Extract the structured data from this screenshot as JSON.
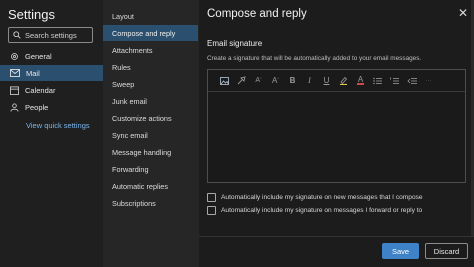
{
  "left": {
    "title": "Settings",
    "search_placeholder": "Search settings",
    "items": [
      {
        "label": "General",
        "icon": "gear-icon"
      },
      {
        "label": "Mail",
        "icon": "mail-icon"
      },
      {
        "label": "Calendar",
        "icon": "calendar-icon"
      },
      {
        "label": "People",
        "icon": "people-icon"
      }
    ],
    "quick_link": "View quick settings"
  },
  "middle": {
    "items": [
      "Layout",
      "Compose and reply",
      "Attachments",
      "Rules",
      "Sweep",
      "Junk email",
      "Customize actions",
      "Sync email",
      "Message handling",
      "Forwarding",
      "Automatic replies",
      "Subscriptions"
    ],
    "active_index": 1
  },
  "main": {
    "title": "Compose and reply",
    "section_title": "Email signature",
    "description": "Create a signature that will be automatically added to your email messages.",
    "toolbar_icons": [
      "image-icon",
      "format-painter-icon",
      "font-size-decrease-icon",
      "font-size-increase-icon",
      "bold-icon",
      "italic-icon",
      "underline-icon",
      "highlight-icon",
      "font-color-icon",
      "bullets-icon",
      "numbering-icon",
      "decrease-indent-icon"
    ],
    "toolbar_glyphs": {
      "bold": "B",
      "italic": "I",
      "underline": "U",
      "font_color": "A",
      "font_up": "A",
      "font_down": "A"
    },
    "checkbox_new": "Automatically include my signature on new messages that I compose",
    "checkbox_reply": "Automatically include my signature on messages I forward or reply to",
    "save": "Save",
    "discard": "Discard",
    "close_glyph": "✕"
  },
  "colors": {
    "accent": "#3e82c8",
    "active_nav": "#2b4f6e",
    "link": "#7bb5ea"
  }
}
